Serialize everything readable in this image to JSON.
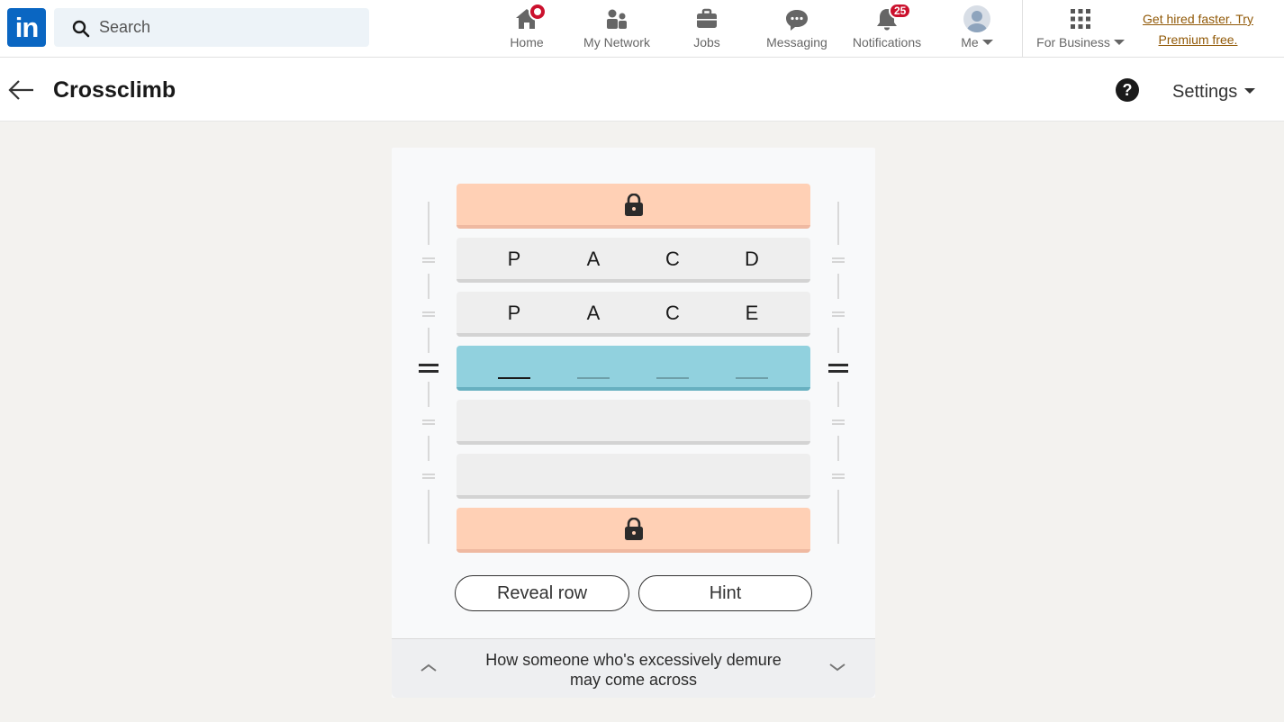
{
  "nav": {
    "logo_text": "in",
    "search_placeholder": "Search",
    "items": [
      {
        "label": "Home",
        "icon": "home-icon",
        "badge": "dot"
      },
      {
        "label": "My Network",
        "icon": "network-icon"
      },
      {
        "label": "Jobs",
        "icon": "briefcase-icon"
      },
      {
        "label": "Messaging",
        "icon": "messaging-icon"
      },
      {
        "label": "Notifications",
        "icon": "bell-icon",
        "badge": "25"
      },
      {
        "label": "Me",
        "icon": "avatar"
      }
    ],
    "business_label": "For Business",
    "premium_line1": "Get hired faster. Try",
    "premium_line2": "Premium free."
  },
  "header": {
    "title": "Crossclimb",
    "help_glyph": "?",
    "settings_label": "Settings"
  },
  "game": {
    "rows": [
      {
        "state": "locked",
        "letters": []
      },
      {
        "state": "filled",
        "letters": [
          "P",
          "A",
          "C",
          "D"
        ]
      },
      {
        "state": "filled",
        "letters": [
          "P",
          "A",
          "C",
          "E"
        ]
      },
      {
        "state": "active",
        "letters": [
          "",
          "",
          "",
          ""
        ]
      },
      {
        "state": "empty",
        "letters": []
      },
      {
        "state": "empty",
        "letters": []
      },
      {
        "state": "locked",
        "letters": []
      }
    ],
    "reveal_label": "Reveal row",
    "hint_label": "Hint",
    "clue_line1": "How someone who's excessively demure",
    "clue_line2": "may come across"
  },
  "colors": {
    "brand": "#0a66c2",
    "locked_row": "#ffd0b5",
    "active_row": "#91d1de",
    "empty_row": "#eeeeee",
    "badge": "#cb112d",
    "premium_link": "#915907"
  }
}
